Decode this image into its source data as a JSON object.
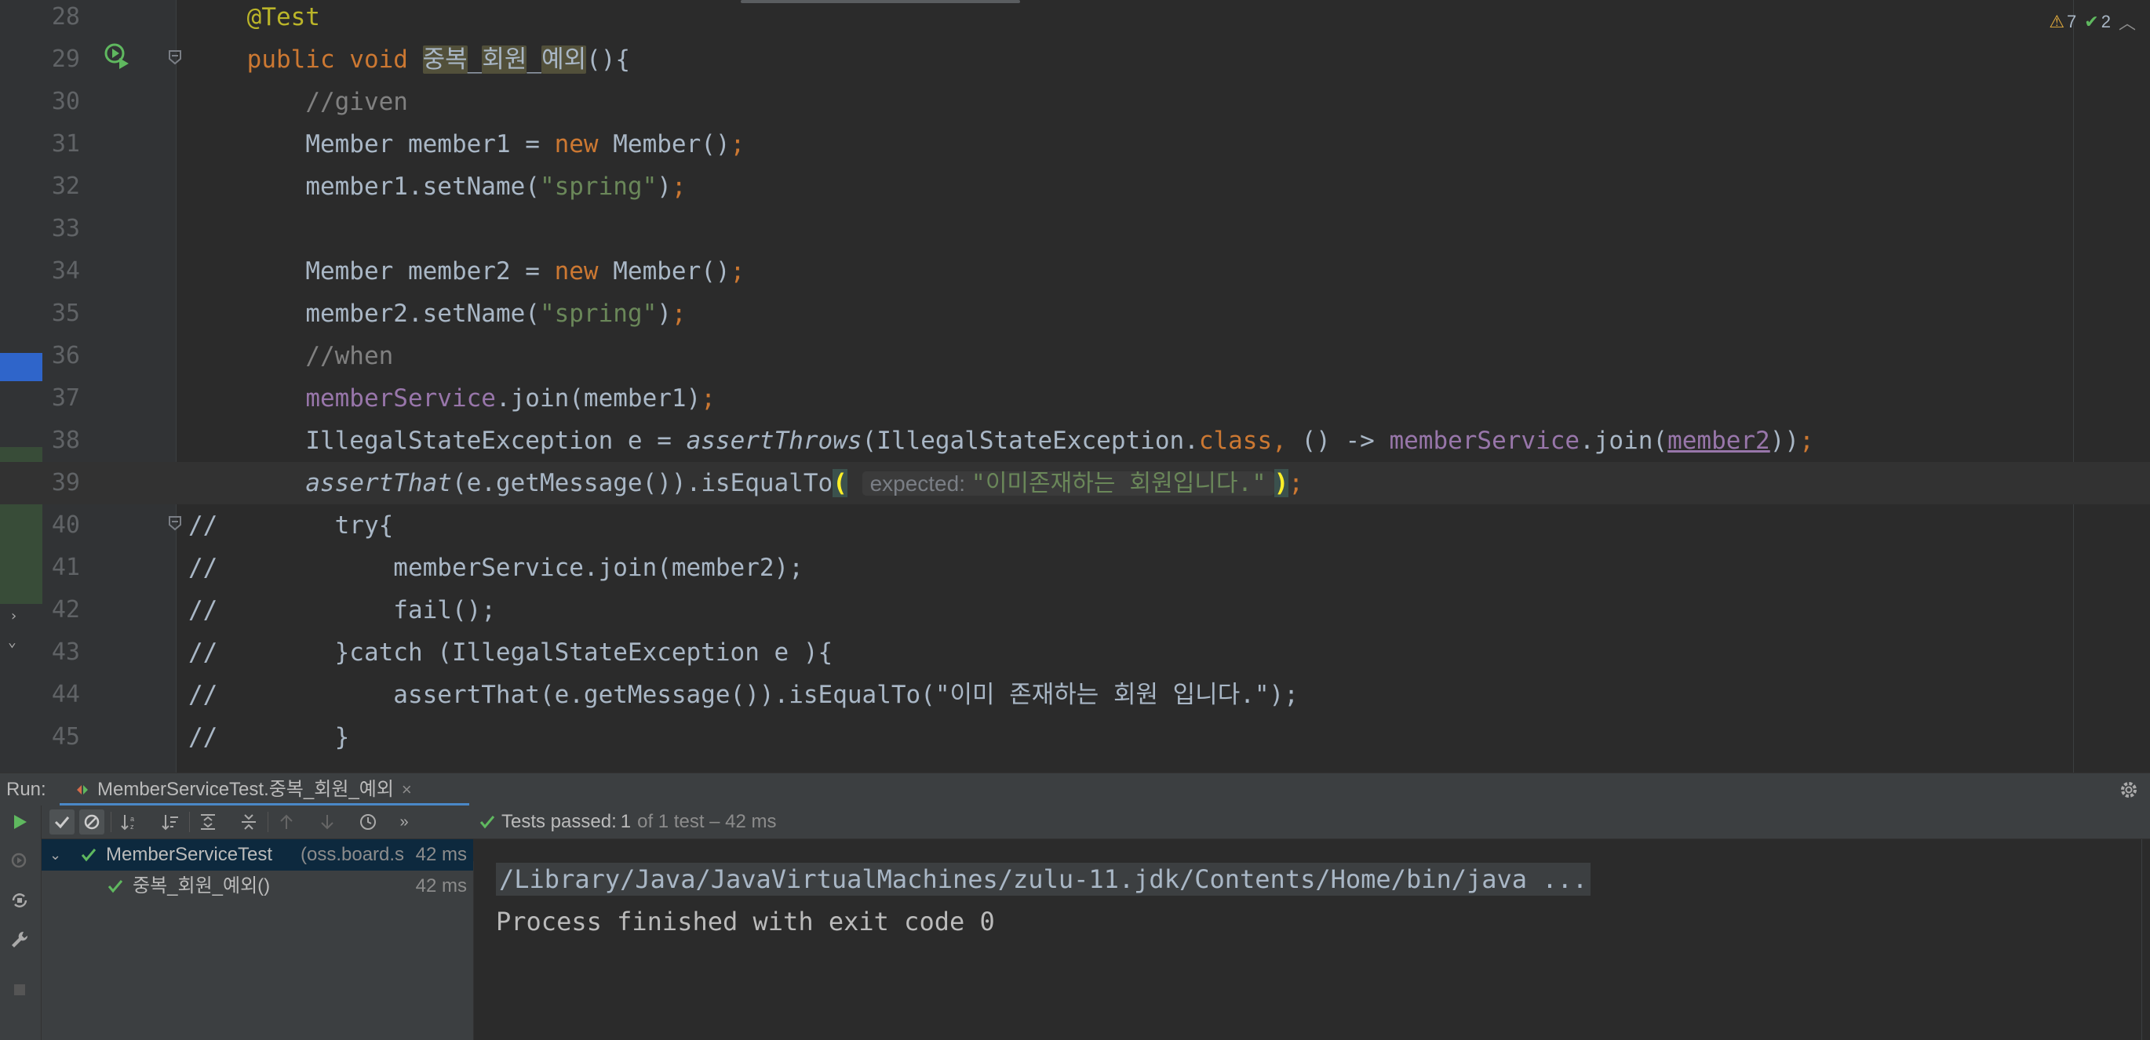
{
  "colors": {
    "background": "#2b2b2b",
    "keyword": "#cc7832",
    "string": "#6a8759",
    "comment": "#808080",
    "field": "#9876aa",
    "annotation": "#bbb529",
    "success": "#5fb85f",
    "selection": "#0d293e"
  },
  "inspection": {
    "warnings": "7",
    "checks": "2"
  },
  "lines": [
    {
      "n": "28",
      "segments": [
        [
          "ann",
          "@Test"
        ]
      ]
    },
    {
      "n": "29",
      "segments": [
        [
          "kw",
          "public void "
        ],
        [
          "hl",
          "중복"
        ],
        [
          "p",
          "_"
        ],
        [
          "hl",
          "회원"
        ],
        [
          "p",
          "_"
        ],
        [
          "hl",
          "예외"
        ],
        [
          "p",
          "(){"
        ]
      ]
    },
    {
      "n": "30",
      "segments": [
        [
          "cm",
          "//given"
        ]
      ]
    },
    {
      "n": "31",
      "segments": [
        [
          "p",
          "Member member1 = "
        ],
        [
          "kw",
          "new "
        ],
        [
          "p",
          "Member()"
        ],
        [
          "kw",
          ";"
        ]
      ]
    },
    {
      "n": "32",
      "segments": [
        [
          "p",
          "member1.setName("
        ],
        [
          "str",
          "\"spring\""
        ],
        [
          "p",
          ")"
        ],
        [
          "kw",
          ";"
        ]
      ]
    },
    {
      "n": "33",
      "segments": []
    },
    {
      "n": "34",
      "segments": [
        [
          "p",
          "Member member2 = "
        ],
        [
          "kw",
          "new "
        ],
        [
          "p",
          "Member()"
        ],
        [
          "kw",
          ";"
        ]
      ]
    },
    {
      "n": "35",
      "segments": [
        [
          "p",
          "member2.setName("
        ],
        [
          "str",
          "\"spring\""
        ],
        [
          "p",
          ")"
        ],
        [
          "kw",
          ";"
        ]
      ]
    },
    {
      "n": "36",
      "segments": [
        [
          "cm",
          "//when"
        ]
      ]
    },
    {
      "n": "37",
      "segments": [
        [
          "fld",
          "memberService"
        ],
        [
          "p",
          ".join(member1)"
        ],
        [
          "kw",
          ";"
        ]
      ]
    },
    {
      "n": "38",
      "segments": [
        [
          "p",
          "IllegalStateException e = "
        ],
        [
          "ital",
          "assertThrows"
        ],
        [
          "p",
          "(IllegalStateException."
        ],
        [
          "kw",
          "class, "
        ],
        [
          "p",
          "() -> "
        ],
        [
          "fld",
          "memberService"
        ],
        [
          "p",
          ".join("
        ],
        [
          "ul",
          "member2"
        ],
        [
          "p",
          "))"
        ],
        [
          "kw",
          ";"
        ]
      ]
    },
    {
      "n": "39",
      "segments": [
        [
          "ital",
          "assertThat"
        ],
        [
          "p",
          "(e.getMessage()).isEqualTo"
        ],
        [
          "brace",
          "("
        ],
        [
          "hint",
          "expected:"
        ],
        [
          "brace",
          ")"
        ],
        [
          "kw",
          ";"
        ]
      ]
    },
    {
      "n": "40",
      "segments": [
        [
          "cm",
          "//        try{"
        ]
      ]
    },
    {
      "n": "41",
      "segments": [
        [
          "cm",
          "//            memberService.join(member2);"
        ]
      ]
    },
    {
      "n": "42",
      "segments": [
        [
          "cm",
          "//            fail();"
        ]
      ]
    },
    {
      "n": "43",
      "segments": [
        [
          "cm",
          "//        }catch (IllegalStateException e ){"
        ]
      ]
    },
    {
      "n": "44",
      "segments": [
        [
          "cm",
          "//            assertThat(e.getMessage()).isEqualTo(\"이미 존재하는 회원 입니다.\");"
        ]
      ]
    },
    {
      "n": "45",
      "segments": [
        [
          "cm",
          "//        }"
        ]
      ]
    }
  ],
  "hint_value": "\"이미존재하는 회원입니다.\"",
  "run": {
    "label": "Run:",
    "tab_title": "MemberServiceTest.중복_회원_예외",
    "tests_passed_label": "Tests passed:",
    "tests_passed_count": "1",
    "tests_passed_detail": "of 1 test – 42 ms"
  },
  "tree": [
    {
      "name": "MemberServiceTest",
      "pkg": "(oss.board.s",
      "time": "42 ms"
    },
    {
      "name": "중복_회원_예외()",
      "time": "42 ms"
    }
  ],
  "console": {
    "command": "/Library/Java/JavaVirtualMachines/zulu-11.jdk/Contents/Home/bin/java ...",
    "result": "Process finished with exit code 0"
  }
}
